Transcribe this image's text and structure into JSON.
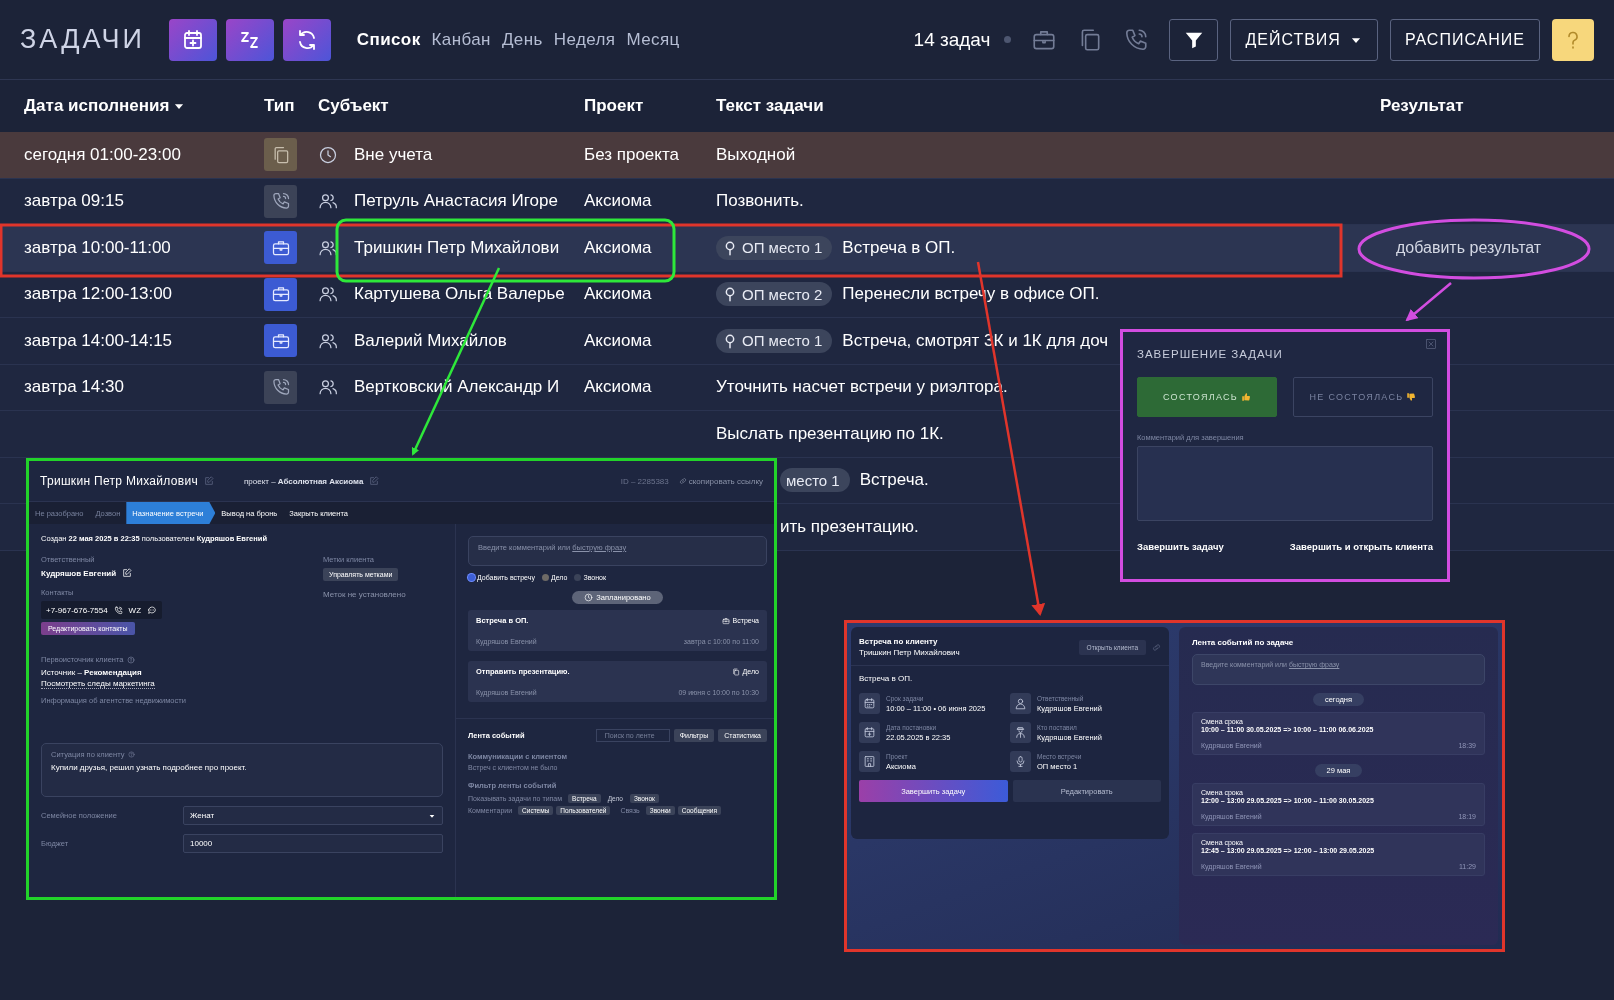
{
  "header": {
    "title": "ЗАДАЧИ",
    "tool_buttons": [
      {
        "kind": "add"
      },
      {
        "kind": "snooze"
      },
      {
        "kind": "refresh"
      }
    ],
    "views": [
      {
        "label": "Список",
        "selected": true
      },
      {
        "label": "Канбан",
        "selected": false
      },
      {
        "label": "День",
        "selected": false
      },
      {
        "label": "Неделя",
        "selected": false
      },
      {
        "label": "Месяц",
        "selected": false
      }
    ],
    "task_count": "14 задач",
    "type_filters": [
      {
        "kind": "meeting"
      },
      {
        "kind": "task"
      },
      {
        "kind": "call"
      }
    ],
    "actions_button": "ДЕЙСТВИЯ",
    "schedule_button": "РАСПИСАНИЕ"
  },
  "table": {
    "columns": [
      {
        "label": "Дата исполнения",
        "sorted": true
      },
      {
        "label": "Тип",
        "sorted": false
      },
      {
        "label": "Субъект",
        "sorted": false
      },
      {
        "label": "Проект",
        "sorted": false
      },
      {
        "label": "Текст задачи",
        "sorted": false
      },
      {
        "label": "Результат",
        "sorted": false
      }
    ],
    "rows": [
      {
        "date": "сегодня 01:00-23:00",
        "kind": "task",
        "subject": {
          "kind": "unassigned",
          "name": "Вне учета"
        },
        "project": "Без проекта",
        "text": "Выходной",
        "day_off": true,
        "selected": false
      },
      {
        "date": "завтра 09:15",
        "kind": "call",
        "subject": {
          "kind": "client",
          "name": "Петруль Анастасия Игоре"
        },
        "project": "Аксиома",
        "text": "Позвонить.",
        "day_off": false,
        "selected": false
      },
      {
        "date": "завтра 10:00-11:00",
        "kind": "meeting",
        "subject": {
          "kind": "client",
          "name": "Тришкин Петр Михайлови"
        },
        "project": "Аксиома",
        "tag": "ОП место 1",
        "text": "Встреча в ОП.",
        "result": "добавить результат",
        "day_off": false,
        "selected": true
      },
      {
        "date": "завтра 12:00-13:00",
        "kind": "meeting",
        "subject": {
          "kind": "client",
          "name": "Картушева Ольга Валерье"
        },
        "project": "Аксиома",
        "tag": "ОП место 2",
        "text": "Перенесли встречу в офисе ОП.",
        "day_off": false,
        "selected": false
      },
      {
        "date": "завтра 14:00-14:15",
        "kind": "meeting",
        "subject": {
          "kind": "client",
          "name": "Валерий Михайлов"
        },
        "project": "Аксиома",
        "tag": "ОП место 1",
        "text": "Встреча, смотрят 3К и 1К для доч",
        "day_off": false,
        "selected": false
      },
      {
        "date": "завтра 14:30",
        "kind": "call",
        "subject": {
          "kind": "client",
          "name": "Вертковский Александр И"
        },
        "project": "Аксиома",
        "text": "Уточнить насчет встречи у риэлтора.",
        "day_off": false,
        "selected": false
      }
    ],
    "covered_rows": [
      {
        "text": "Выслать презентацию по 1К.",
        "overlapped": false
      },
      {
        "tag": "место 1",
        "text": "Встреча.",
        "overlapped": true
      },
      {
        "text": "ить презентацию.",
        "overlapped": true
      }
    ]
  },
  "client_card": {
    "name": "Тришкин Петр Михайлович",
    "project": "проект – **Абсолютная Аксиома**",
    "id": "ID – 2285383",
    "copy_link": "скопировать ссылку",
    "stages": [
      {
        "label": "Не разобрано",
        "passed": true,
        "selected": false
      },
      {
        "label": "Дозвон",
        "passed": true,
        "selected": false
      },
      {
        "label": "Назначение встречи",
        "passed": false,
        "selected": true
      },
      {
        "label": "Вывод на бронь",
        "passed": false,
        "selected": false
      },
      {
        "label": "Закрыть клиента",
        "passed": false,
        "selected": false
      }
    ],
    "created": "Создан **22 мая 2025 в 22:35** пользователем **Кудряшов Евгений**",
    "responsible_label": "Ответственный",
    "responsible": "Кудряшов Евгений",
    "tags_label": "Метки клиента",
    "tags_button": "Управлять метками",
    "tags_empty": "Меток не установлено",
    "contacts_label": "Контакты",
    "phone": "+7-967-676-7554",
    "messenger": "WZ",
    "edit_contacts": "Редактировать контакты",
    "source_label": "Первоисточник клиента",
    "source": "Источник – **Рекомендация**",
    "marketing_link": "Посмотреть следы маркетинга",
    "agency_info": "Информация об агентстве недвижимости",
    "situation_label": "Ситуация по клиенту",
    "situation": "Купили друзья, решил узнать подробнее про проект.",
    "family_label": "Семейное положение",
    "family": "Женат",
    "budget_label": "Бюджет",
    "budget": "10000",
    "comment_placeholder": "Введите комментарий или ",
    "quick_phrase": "быструю фразу",
    "add_options": [
      {
        "label": "Добавить встречу",
        "color": "#3d5fd6",
        "selected": true
      },
      {
        "label": "Дело",
        "color": "#6e6a66",
        "selected": false
      },
      {
        "label": "Звонок",
        "color": "#3b4358",
        "selected": false
      }
    ],
    "planned": "Запланировано",
    "tasks": [
      {
        "title": "Встреча в ОП.",
        "kind": "meeting",
        "type": "Встреча",
        "author": "Кудряшов Евгений",
        "when": "завтра с 10:00 по 11:00"
      },
      {
        "title": "Отправить презентацию.",
        "kind": "task",
        "type": "Дело",
        "author": "Кудряшов Евгений",
        "when": "09 июня с 10:00 по 10:30"
      }
    ],
    "feed_title": "Лента событий",
    "feed_search": "Поиск по ленте",
    "filters_button": "Фильтры",
    "stats_button": "Статистика",
    "comm_title": "Коммуникации с клиентом",
    "comm_empty": "Встреч с клиентом не было",
    "filter_title": "Фильтр ленты событий",
    "filter_groups": [
      {
        "label": "Показывать задачи по типам",
        "chips": [
          {
            "label": "Встреча",
            "on": true
          },
          {
            "label": "Дело",
            "on": false
          },
          {
            "label": "Звонок",
            "on": true
          }
        ]
      },
      {
        "label": "Комментарии",
        "chips": [
          {
            "label": "Системы",
            "on": true
          },
          {
            "label": "Пользователей",
            "on": true
          }
        ]
      },
      {
        "label": "Связь",
        "chips": [
          {
            "label": "Звонки",
            "on": true
          },
          {
            "label": "Сообщения",
            "on": true
          }
        ]
      }
    ]
  },
  "complete_dialog": {
    "title": "ЗАВЕРШЕНИЕ ЗАДАЧИ",
    "outcomes": [
      {
        "label": "СОСТОЯЛАСЬ",
        "kind": "up",
        "selected": true
      },
      {
        "label": "НЕ СОСТОЯЛАСЬ",
        "kind": "down",
        "selected": false
      }
    ],
    "comment_label": "Комментарий для завершения",
    "finish": "Завершить задачу",
    "finish_open": "Завершить и открыть клиента"
  },
  "task_panel": {
    "heading": "Встреча по клиенту",
    "client": "Тришкин Петр Михайлович",
    "open_client": "Открыть клиента",
    "text": "Встреча в ОП.",
    "fields": [
      {
        "kind": "deadline",
        "label": "Срок задачи",
        "value": "10:00 – 11:00 • 06 июня 2025"
      },
      {
        "kind": "user",
        "label": "Ответственный",
        "value": "Кудряшов Евгений"
      },
      {
        "kind": "created",
        "label": "Дата постановки",
        "value": "22.05.2025 в 22:35"
      },
      {
        "kind": "author",
        "label": "Кто поставил",
        "value": "Кудряшов Евгений"
      },
      {
        "kind": "project",
        "label": "Проект",
        "value": "Аксиома"
      },
      {
        "kind": "place",
        "label": "Место встречи",
        "value": "ОП место 1"
      }
    ],
    "finish": "Завершить задачу",
    "edit": "Редактировать"
  },
  "feed_panel": {
    "title": "Лента событий по задаче",
    "placeholder": "Введите комментарий или ",
    "quick_phrase": "быструю фразу",
    "items": [
      {
        "kind": "date",
        "label": "сегодня"
      },
      {
        "kind": "event",
        "title": "Смена срока",
        "change": "10:00 – 11:00 30.05.2025 => 10:00 – 11:00 06.06.2025",
        "author": "Кудряшов Евгений",
        "time": "18:39"
      },
      {
        "kind": "date",
        "label": "29 мая"
      },
      {
        "kind": "event",
        "title": "Смена срока",
        "change": "12:00 – 13:00 29.05.2025 => 10:00 – 11:00 30.05.2025",
        "author": "Кудряшов Евгений",
        "time": "18:19"
      },
      {
        "kind": "event",
        "title": "Смена срока",
        "change": "12:45 – 13:00 29.05.2025 => 12:00 – 13:00 29.05.2025",
        "author": "Кудряшов Евгений",
        "time": "11:29"
      }
    ]
  }
}
